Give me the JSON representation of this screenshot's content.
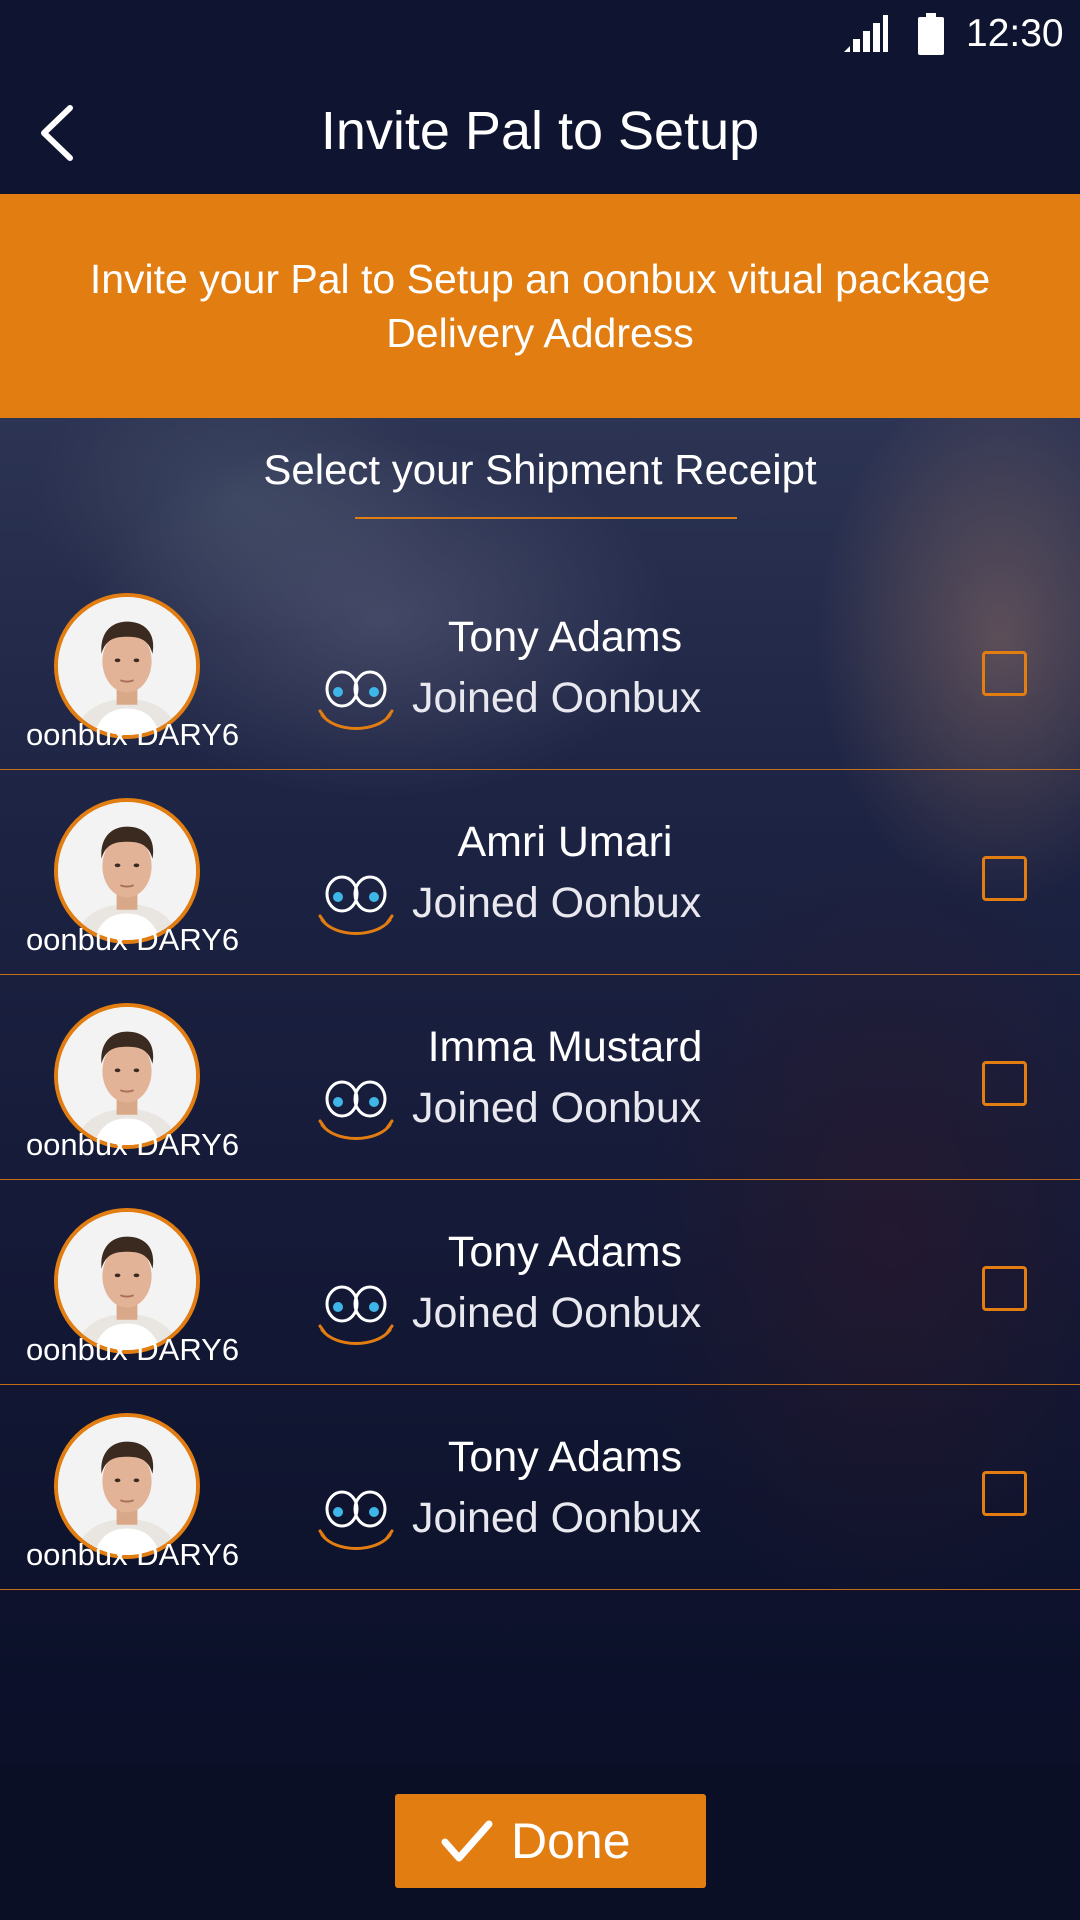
{
  "status_bar": {
    "time": "12:30",
    "icons": [
      "signal-icon",
      "battery-icon"
    ]
  },
  "header": {
    "title": "Invite Pal to Setup",
    "back_icon": "chevron-left-icon"
  },
  "banner": {
    "text": "Invite your Pal to Setup an oonbux vitual package Delivery Address"
  },
  "section": {
    "title": "Select your Shipment Receipt"
  },
  "contacts": [
    {
      "handle": "oonbux DARY6",
      "name": "Tony Adams",
      "status": "Joined Oonbux",
      "checked": false
    },
    {
      "handle": "oonbux DARY6",
      "name": "Amri Umari",
      "status": "Joined Oonbux",
      "checked": false
    },
    {
      "handle": "oonbux DARY6",
      "name": "Imma Mustard",
      "status": "Joined Oonbux",
      "checked": false
    },
    {
      "handle": "oonbux DARY6",
      "name": "Tony Adams",
      "status": "Joined Oonbux",
      "checked": false
    },
    {
      "handle": "oonbux DARY6",
      "name": "Tony Adams",
      "status": "Joined Oonbux",
      "checked": false
    }
  ],
  "done_button": {
    "label": "Done",
    "icon": "checkmark-icon"
  },
  "colors": {
    "accent": "#e27d12",
    "header_bg": "#0f1530",
    "eye_fill": "#3fb6e8"
  }
}
